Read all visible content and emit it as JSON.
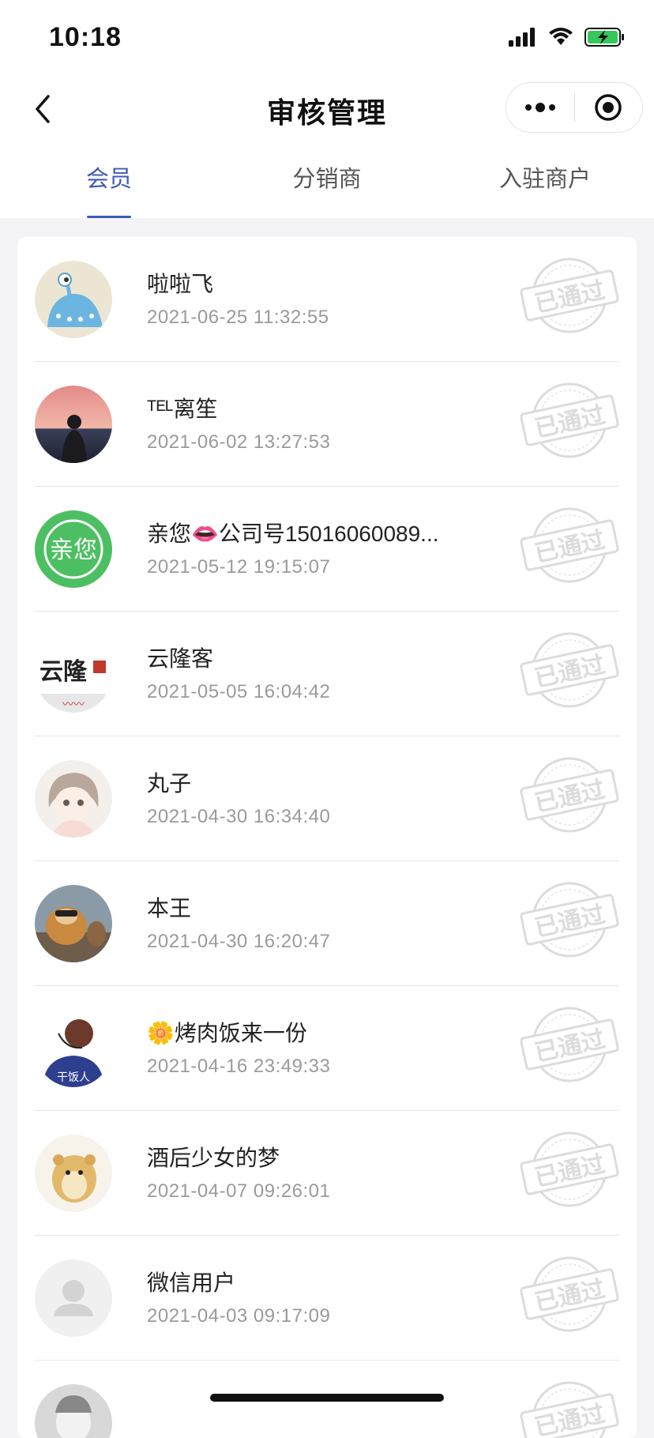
{
  "status_bar": {
    "time": "10:18"
  },
  "nav": {
    "title": "审核管理"
  },
  "tabs": [
    {
      "label": "会员",
      "active": true
    },
    {
      "label": "分销商",
      "active": false
    },
    {
      "label": "入驻商户",
      "active": false
    }
  ],
  "members": [
    {
      "name": "啦啦飞",
      "time": "2021-06-25 11:32:55",
      "status": "已通过",
      "avatar": "blue-monster-avatar"
    },
    {
      "name": "ᵀᴱᴸ离笙",
      "time": "2021-06-02 13:27:53",
      "status": "已通过",
      "avatar": "sunset-photo-avatar"
    },
    {
      "name": "亲您👄公司号15016060089...",
      "time": "2021-05-12 19:15:07",
      "status": "已通过",
      "avatar": "green-logo-avatar"
    },
    {
      "name": "云隆客",
      "time": "2021-05-05 16:04:42",
      "status": "已通过",
      "avatar": "calligraphy-logo-avatar"
    },
    {
      "name": "丸子",
      "time": "2021-04-30 16:34:40",
      "status": "已通过",
      "avatar": "anime-girl-avatar"
    },
    {
      "name": "本王",
      "time": "2021-04-30 16:20:47",
      "status": "已通过",
      "avatar": "dog-photo-avatar"
    },
    {
      "name": "🌼烤肉饭来一份",
      "time": "2021-04-16 23:49:33",
      "status": "已通过",
      "avatar": "cartoon-boy-avatar"
    },
    {
      "name": "酒后少女的梦",
      "time": "2021-04-07 09:26:01",
      "status": "已通过",
      "avatar": "hamster-avatar"
    },
    {
      "name": "微信用户",
      "time": "2021-04-03 09:17:09",
      "status": "已通过",
      "avatar": "default-user-avatar"
    },
    {
      "name": "",
      "time": "",
      "status": "已通过",
      "avatar": "partial-avatar"
    }
  ],
  "colors": {
    "accent": "#3f5bb8",
    "stamp": "#dddddd",
    "background": "#f4f4f6"
  }
}
